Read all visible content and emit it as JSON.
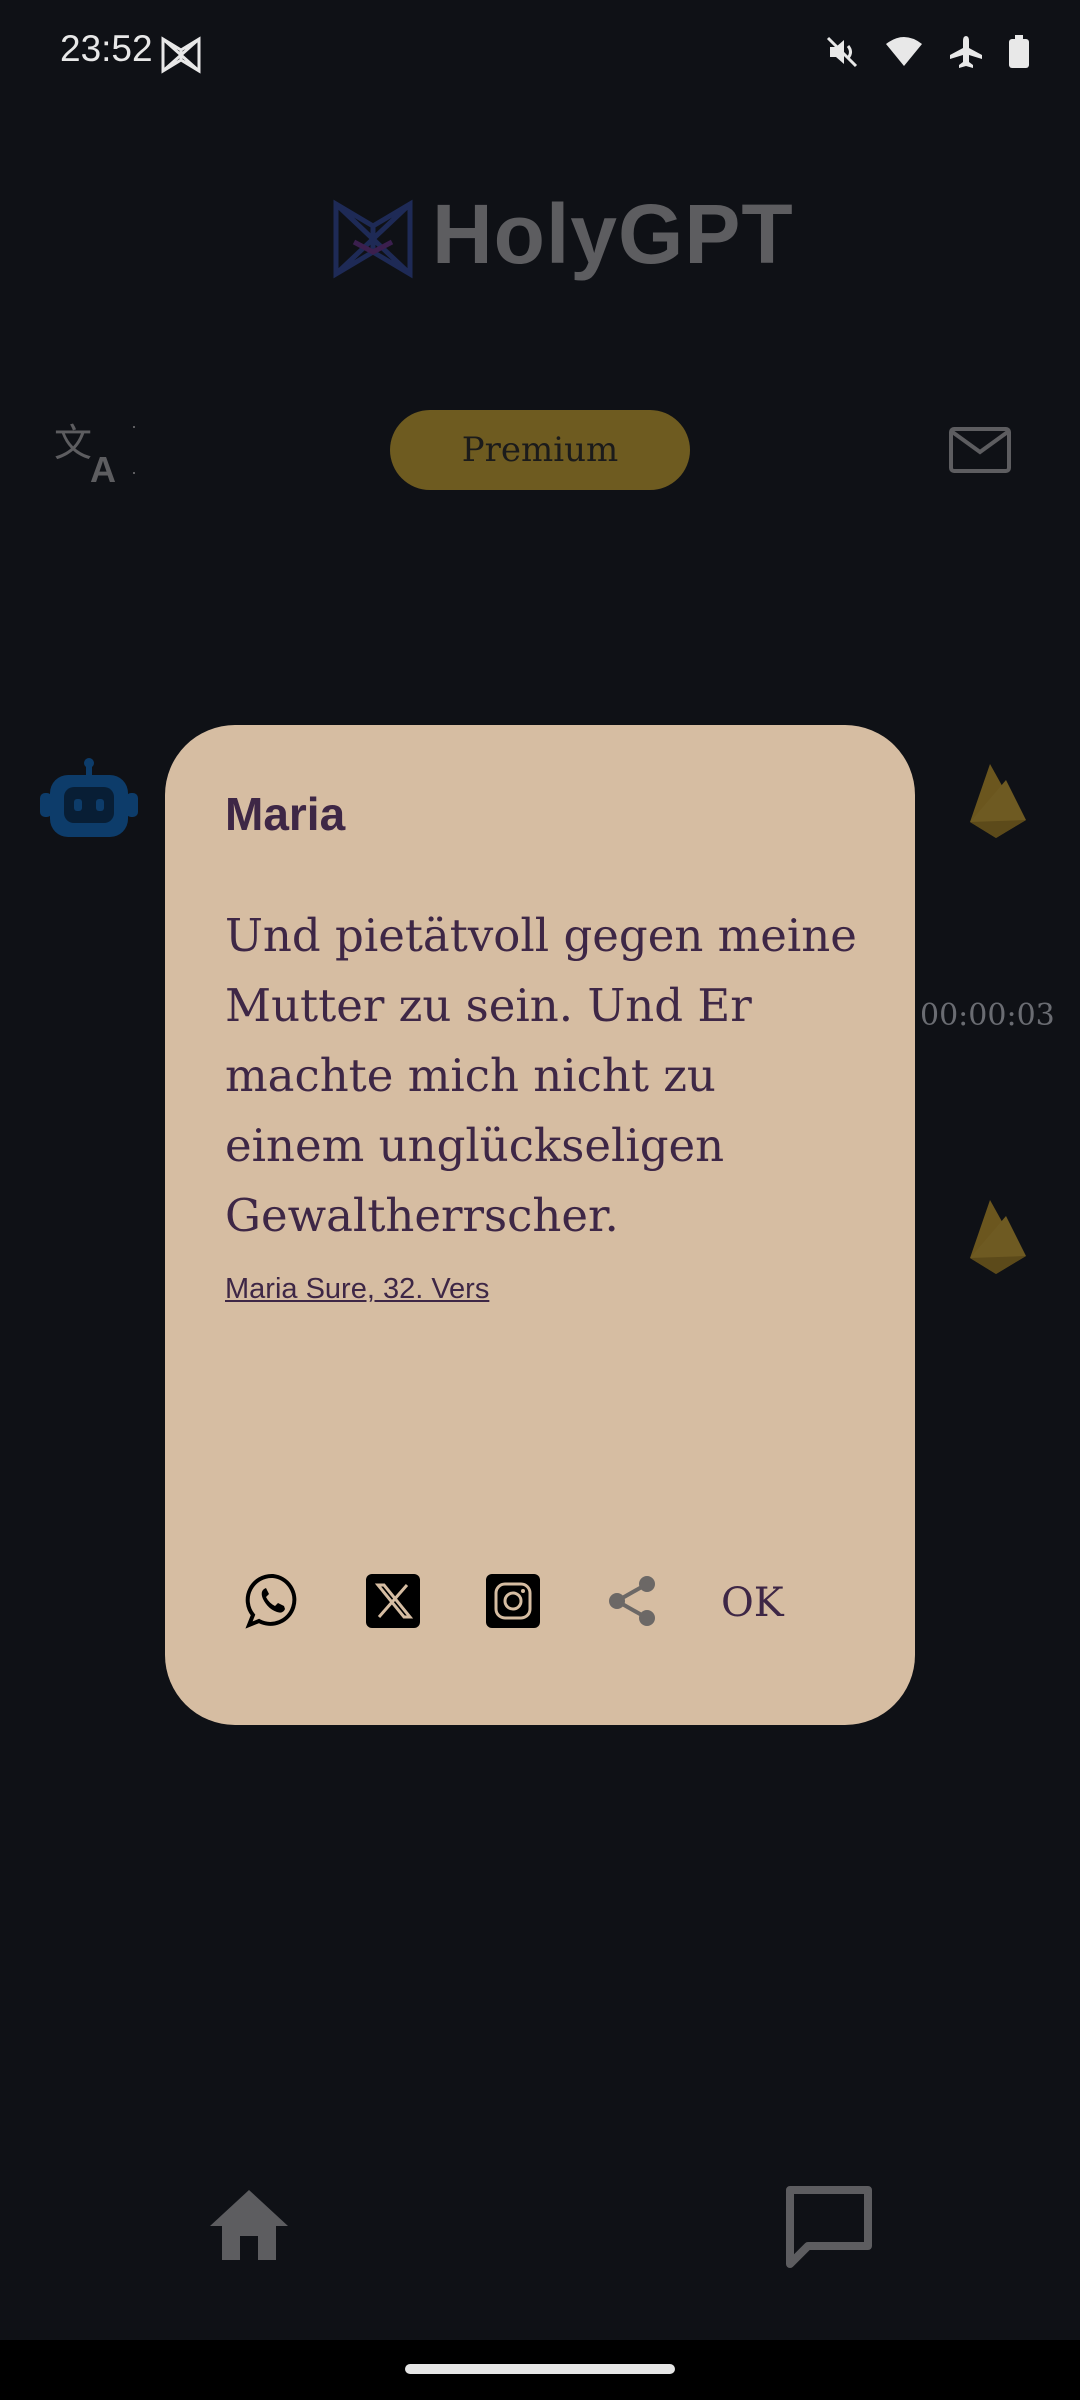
{
  "status_bar": {
    "time": "23:52"
  },
  "header": {
    "app_title": "HolyGPT",
    "premium_label": "Premium"
  },
  "background": {
    "timer": "00:00:03"
  },
  "dialog": {
    "title": "Maria",
    "verse": "Und pietätvoll gegen meine Mutter zu sein. Und Er machte mich nicht zu einem unglückseligen Gewaltherrscher.",
    "reference": "Maria Sure, 32. Vers",
    "ok_label": "OK"
  },
  "icons": [
    "book-icon",
    "mute-icon",
    "wifi-icon",
    "airplane-icon",
    "battery-icon",
    "translate-icon",
    "mail-icon",
    "robot-icon",
    "flame-icon",
    "whatsapp-icon",
    "x-icon",
    "instagram-icon",
    "share-icon",
    "home-icon",
    "chat-icon"
  ],
  "colors": {
    "dialog_bg": "#d6bda2",
    "dialog_text": "#3e2746",
    "premium": "#6e5b20",
    "background": "#0f1116"
  }
}
